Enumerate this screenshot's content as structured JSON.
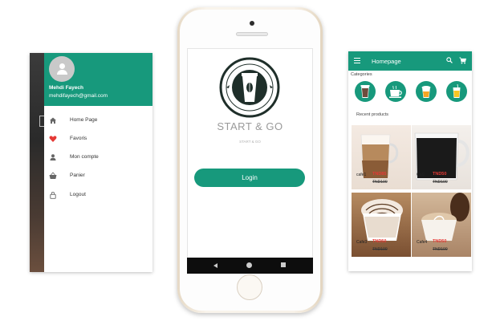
{
  "drawer": {
    "user_name": "Mehdi Fayech",
    "user_email": "mehdifayech@gmail.com",
    "items": [
      {
        "label": "Home Page",
        "icon": "home-icon"
      },
      {
        "label": "Favoris",
        "icon": "heart-icon"
      },
      {
        "label": "Mon compte",
        "icon": "person-icon"
      },
      {
        "label": "Panier",
        "icon": "basket-icon"
      },
      {
        "label": "Logout",
        "icon": "lock-icon"
      }
    ]
  },
  "login": {
    "logo_text_top": "START & GO",
    "logo_text_bottom": "PREMIUM QUALITY",
    "title": "START & GO",
    "subtitle": "START & GO",
    "button_label": "Login"
  },
  "home": {
    "title": "Homepage",
    "categories_label": "Categories",
    "recent_label": "Recent products",
    "products": [
      {
        "name": "cafe1",
        "price": "TND85",
        "old_price": "TND100"
      },
      {
        "name": "Caf2",
        "price": "TND50",
        "old_price": "TND100"
      },
      {
        "name": "Cafe3",
        "price": "TND50",
        "old_price": "TND100"
      },
      {
        "name": "Cafe4",
        "price": "TND50",
        "old_price": "TND100"
      }
    ]
  },
  "colors": {
    "accent": "#17997c",
    "sale": "#e53935",
    "nav_bar": "#0d0d0d"
  }
}
